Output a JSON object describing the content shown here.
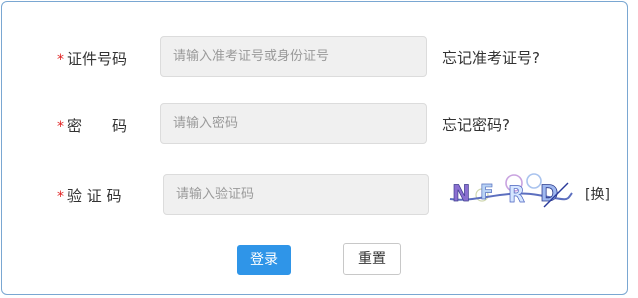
{
  "form": {
    "id_number": {
      "required_mark": "*",
      "label": "证件号码",
      "placeholder": "请输入准考证号或身份证号",
      "link": "忘记准考证号?"
    },
    "password": {
      "required_mark": "*",
      "label": "密　　码",
      "placeholder": "请输入密码",
      "link": "忘记密码?"
    },
    "captcha": {
      "required_mark": "*",
      "label": "验 证 码",
      "placeholder": "请输入验证码",
      "image_text": "NFRD",
      "refresh": "[换]"
    }
  },
  "buttons": {
    "login": "登录",
    "reset": "重置"
  },
  "colors": {
    "border": "#7aa7d2",
    "required": "#e02020",
    "primary": "#2f95e8"
  }
}
